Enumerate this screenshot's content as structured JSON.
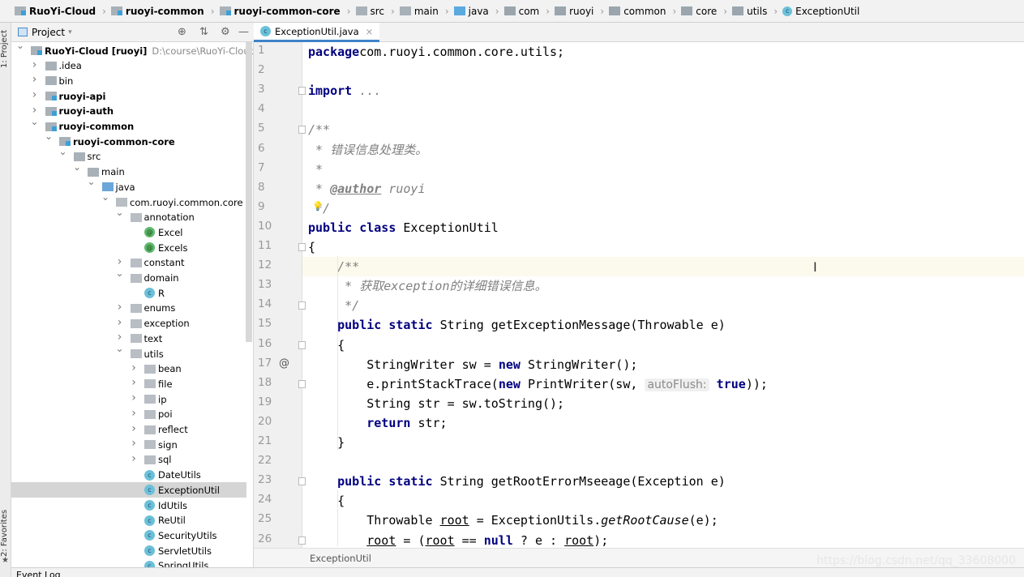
{
  "breadcrumb": [
    {
      "label": "RuoYi-Cloud",
      "icon": "module-icon",
      "bold": true
    },
    {
      "label": "ruoyi-common",
      "icon": "module-icon",
      "bold": true
    },
    {
      "label": "ruoyi-common-core",
      "icon": "module-icon",
      "bold": true
    },
    {
      "label": "src",
      "icon": "folder-icon"
    },
    {
      "label": "main",
      "icon": "folder-icon"
    },
    {
      "label": "java",
      "icon": "source-folder-icon"
    },
    {
      "label": "com",
      "icon": "package-icon"
    },
    {
      "label": "ruoyi",
      "icon": "package-icon"
    },
    {
      "label": "common",
      "icon": "package-icon"
    },
    {
      "label": "core",
      "icon": "package-icon"
    },
    {
      "label": "utils",
      "icon": "package-icon"
    },
    {
      "label": "ExceptionUtil",
      "icon": "class-icon"
    }
  ],
  "left_strip": {
    "project": "1: Project",
    "favorites": "2: Favorites"
  },
  "project_panel": {
    "title": "Project"
  },
  "tree": [
    {
      "level": 0,
      "label": "RuoYi-Cloud [ruoyi]",
      "path": "D:\\course\\RuoYi-Cloud\\code\\",
      "type": "module",
      "expanded": true
    },
    {
      "level": 1,
      "label": ".idea",
      "type": "folder",
      "expanded": false
    },
    {
      "level": 1,
      "label": "bin",
      "type": "folder",
      "expanded": false
    },
    {
      "level": 1,
      "label": "ruoyi-api",
      "type": "module",
      "bold": true,
      "expanded": false
    },
    {
      "level": 1,
      "label": "ruoyi-auth",
      "type": "module",
      "bold": true,
      "expanded": false
    },
    {
      "level": 1,
      "label": "ruoyi-common",
      "type": "module",
      "bold": true,
      "expanded": true
    },
    {
      "level": 2,
      "label": "ruoyi-common-core",
      "type": "module",
      "bold": true,
      "expanded": true
    },
    {
      "level": 3,
      "label": "src",
      "type": "folder",
      "expanded": true
    },
    {
      "level": 4,
      "label": "main",
      "type": "folder",
      "expanded": true
    },
    {
      "level": 5,
      "label": "java",
      "type": "source",
      "expanded": true
    },
    {
      "level": 6,
      "label": "com.ruoyi.common.core",
      "type": "package",
      "expanded": true
    },
    {
      "level": 7,
      "label": "annotation",
      "type": "package",
      "expanded": true
    },
    {
      "level": 8,
      "label": "Excel",
      "type": "annotation"
    },
    {
      "level": 8,
      "label": "Excels",
      "type": "annotation"
    },
    {
      "level": 7,
      "label": "constant",
      "type": "package",
      "expanded": false
    },
    {
      "level": 7,
      "label": "domain",
      "type": "package",
      "expanded": true
    },
    {
      "level": 8,
      "label": "R",
      "type": "class"
    },
    {
      "level": 7,
      "label": "enums",
      "type": "package",
      "expanded": false
    },
    {
      "level": 7,
      "label": "exception",
      "type": "package",
      "expanded": false
    },
    {
      "level": 7,
      "label": "text",
      "type": "package",
      "expanded": false
    },
    {
      "level": 7,
      "label": "utils",
      "type": "package",
      "expanded": true
    },
    {
      "level": 8,
      "label": "bean",
      "type": "package",
      "expanded": false
    },
    {
      "level": 8,
      "label": "file",
      "type": "package",
      "expanded": false
    },
    {
      "level": 8,
      "label": "ip",
      "type": "package",
      "expanded": false
    },
    {
      "level": 8,
      "label": "poi",
      "type": "package",
      "expanded": false
    },
    {
      "level": 8,
      "label": "reflect",
      "type": "package",
      "expanded": false
    },
    {
      "level": 8,
      "label": "sign",
      "type": "package",
      "expanded": false
    },
    {
      "level": 8,
      "label": "sql",
      "type": "package",
      "expanded": false
    },
    {
      "level": 8,
      "label": "DateUtils",
      "type": "class"
    },
    {
      "level": 8,
      "label": "ExceptionUtil",
      "type": "class",
      "selected": true
    },
    {
      "level": 8,
      "label": "IdUtils",
      "type": "class"
    },
    {
      "level": 8,
      "label": "ReUtil",
      "type": "class"
    },
    {
      "level": 8,
      "label": "SecurityUtils",
      "type": "class"
    },
    {
      "level": 8,
      "label": "ServletUtils",
      "type": "class"
    },
    {
      "level": 8,
      "label": "SpringUtils",
      "type": "class"
    }
  ],
  "editor": {
    "tab": "ExceptionUtil.java",
    "current_line": 12,
    "lines": [
      [
        [
          "kw",
          "package"
        ],
        [
          "",
          "com.ruoyi.common.core.utils;"
        ]
      ],
      [],
      [
        [
          "kw",
          "import"
        ],
        [
          "",
          ""
        ],
        [
          "cm",
          " ..."
        ]
      ],
      [],
      [
        [
          "cm",
          "/**"
        ]
      ],
      [
        [
          "cm",
          " * 错误信息处理类。"
        ]
      ],
      [
        [
          "cm",
          " *"
        ]
      ],
      [
        [
          "cm",
          " * "
        ],
        [
          "tag",
          "@author"
        ],
        [
          "cm",
          " ruoyi"
        ]
      ],
      [
        [
          "cm",
          " */"
        ]
      ],
      [
        [
          "kw",
          "public class "
        ],
        [
          "",
          "ExceptionUtil"
        ]
      ],
      [
        [
          "",
          "{"
        ]
      ],
      [
        [
          "cm",
          "    /**"
        ]
      ],
      [
        [
          "cm",
          "     * 获取exception的详细错误信息。"
        ]
      ],
      [
        [
          "cm",
          "     */"
        ]
      ],
      [
        [
          "kw",
          "    public static "
        ],
        [
          "",
          "String getExceptionMessage(Throwable e)"
        ]
      ],
      [
        [
          "",
          "    {"
        ]
      ],
      [
        [
          "",
          "        StringWriter sw = "
        ],
        [
          "kw",
          "new "
        ],
        [
          "",
          "StringWriter();"
        ]
      ],
      [
        [
          "",
          "        e.printStackTrace("
        ],
        [
          "kw",
          "new "
        ],
        [
          "",
          "PrintWriter(sw, "
        ],
        [
          "hint",
          "autoFlush:"
        ],
        [
          "kw",
          " true"
        ],
        [
          "",
          "));"
        ]
      ],
      [
        [
          "",
          "        String str = sw.toString();"
        ]
      ],
      [
        [
          "kw",
          "        return "
        ],
        [
          "",
          "str;"
        ]
      ],
      [
        [
          "",
          "    }"
        ]
      ],
      [],
      [
        [
          "kw",
          "    public static "
        ],
        [
          "",
          "String getRootErrorMseeage(Exception e)"
        ]
      ],
      [
        [
          "",
          "    {"
        ]
      ],
      [
        [
          "",
          "        Throwable "
        ],
        [
          "ul",
          "root"
        ],
        [
          "",
          " = ExceptionUtils."
        ],
        [
          "it",
          "getRootCause"
        ],
        [
          "",
          "(e);"
        ]
      ],
      [
        [
          "",
          "        "
        ],
        [
          "ul",
          "root"
        ],
        [
          "",
          " = ("
        ],
        [
          "ul",
          "root"
        ],
        [
          "",
          ""
        ],
        [
          "",
          " == "
        ],
        [
          "kw",
          "null"
        ],
        [
          "",
          " ? e : "
        ],
        [
          "ul",
          "root"
        ],
        [
          "",
          ");"
        ]
      ]
    ],
    "gutter_marks": {
      "17": "@"
    }
  },
  "status": {
    "breadcrumb": "ExceptionUtil"
  },
  "bottom": {
    "event_log": "Event Log"
  },
  "watermark": "https://blog.csdn.net/qq_33608000"
}
